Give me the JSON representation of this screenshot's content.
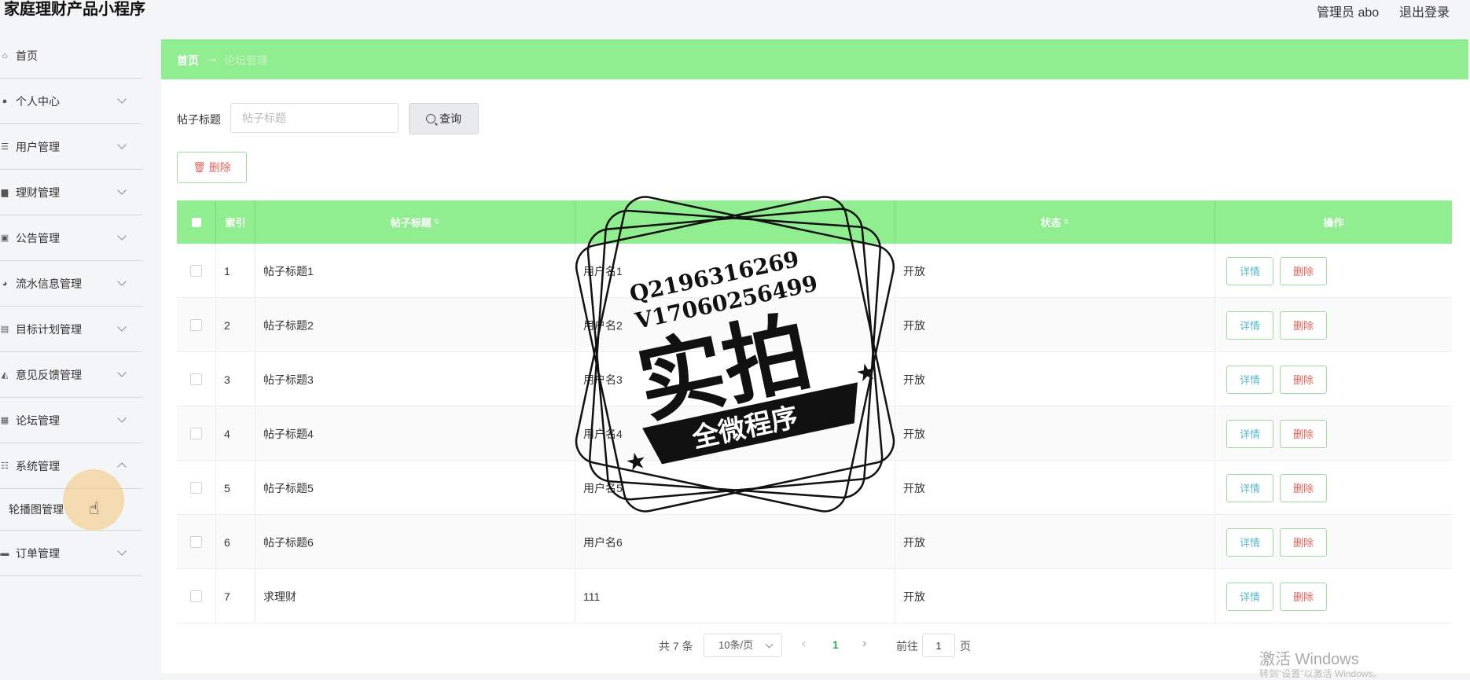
{
  "header": {
    "app_title": "家庭理财产品小程序",
    "admin": "管理员 abo",
    "logout": "退出登录"
  },
  "sidebar": {
    "items": [
      {
        "label": "首页",
        "icon": "home-icon"
      },
      {
        "label": "个人中心",
        "icon": "user-icon"
      },
      {
        "label": "用户管理",
        "icon": "list-icon"
      },
      {
        "label": "理财管理",
        "icon": "save-icon"
      },
      {
        "label": "公告管理",
        "icon": "notice-icon"
      },
      {
        "label": "流水信息管理",
        "icon": "palette-icon"
      },
      {
        "label": "目标计划管理",
        "icon": "target-icon"
      },
      {
        "label": "意见反馈管理",
        "icon": "feedback-icon"
      },
      {
        "label": "论坛管理",
        "icon": "forum-icon"
      },
      {
        "label": "系统管理",
        "icon": "settings-icon"
      },
      {
        "label": "轮播图管理",
        "icon": ""
      },
      {
        "label": "订单管理",
        "icon": "order-icon"
      }
    ]
  },
  "breadcrumb": {
    "home": "首页",
    "arrow": "→",
    "current": "论坛管理"
  },
  "search": {
    "label": "帖子标题",
    "placeholder": "帖子标题",
    "button": "查询"
  },
  "toolbar": {
    "delete": "删除"
  },
  "table": {
    "headers": [
      "索引",
      "帖子标题",
      "",
      "状态",
      "操作"
    ],
    "rows": [
      {
        "index": "1",
        "title": "帖子标题1",
        "user": "用户名1",
        "status": "开放"
      },
      {
        "index": "2",
        "title": "帖子标题2",
        "user": "用户名2",
        "status": "开放"
      },
      {
        "index": "3",
        "title": "帖子标题3",
        "user": "用户名3",
        "status": "开放"
      },
      {
        "index": "4",
        "title": "帖子标题4",
        "user": "用户名4",
        "status": "开放"
      },
      {
        "index": "5",
        "title": "帖子标题5",
        "user": "用户名5",
        "status": "开放"
      },
      {
        "index": "6",
        "title": "帖子标题6",
        "user": "用户名6",
        "status": "开放"
      },
      {
        "index": "7",
        "title": "求理财",
        "user": "111",
        "status": "开放"
      }
    ],
    "detail_label": "详情",
    "delete_label": "删除"
  },
  "pagination": {
    "total": "共 7 条",
    "page_size": "10条/页",
    "current": "1",
    "goto": "前往",
    "goto_value": "1",
    "page_suffix": "页"
  },
  "windows": {
    "activate": "激活 Windows",
    "activate_sub": "转到\"设置\"以激活 Windows。"
  },
  "watermark": {
    "line1": "Q2196316269",
    "line2": "V17060256499",
    "big": "实拍",
    "banner": "全微程序"
  }
}
